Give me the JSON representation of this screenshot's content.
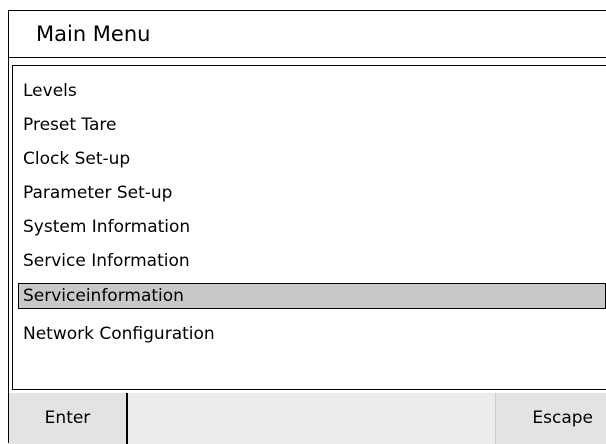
{
  "window": {
    "title": "Main Menu"
  },
  "menu": {
    "items": [
      {
        "label": "Levels"
      },
      {
        "label": "Preset Tare"
      },
      {
        "label": "Clock Set-up"
      },
      {
        "label": "Parameter Set-up"
      },
      {
        "label": "System Information"
      },
      {
        "label": "Service Information"
      },
      {
        "label": "Serviceinformation"
      },
      {
        "label": "Network Configuration"
      }
    ],
    "selected_index": 6
  },
  "buttons": {
    "enter": "Enter",
    "escape": "Escape"
  },
  "colors": {
    "selection": "#c8c8c8",
    "button_bg": "#e3e3e3",
    "border": "#000000"
  }
}
